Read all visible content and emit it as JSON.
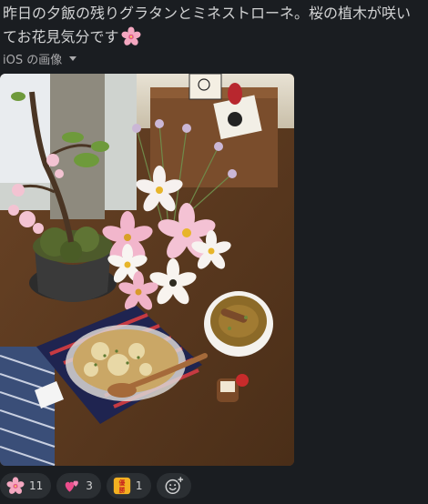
{
  "message": {
    "text": "昨日の夕飯の残りグラタンとミネストローネ。桜の植木が咲いてお花見気分です",
    "trailing_emoji": "cherry-blossom"
  },
  "attachment": {
    "label": "iOS の画像"
  },
  "reactions": [
    {
      "emoji": "cherry-blossom",
      "count": "11"
    },
    {
      "emoji": "two-hearts",
      "count": "3"
    },
    {
      "emoji": "yuushou-badge",
      "label_text": "優勝",
      "count": "1"
    }
  ],
  "add_reaction": {
    "icon": "add-emoji-icon"
  },
  "colors": {
    "background": "#1a1d21",
    "text": "#d1d2d3",
    "muted": "#ababad",
    "reaction_bg": "#2b2f33"
  }
}
